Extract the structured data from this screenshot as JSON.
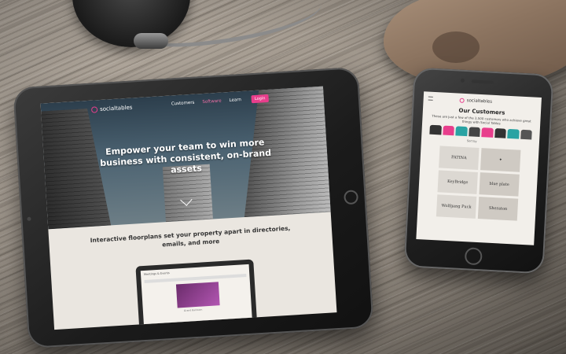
{
  "tablet": {
    "logo": "socialtables",
    "nav": [
      "Customers",
      "Software",
      "Learn"
    ],
    "nav_active_index": 1,
    "login": "Login",
    "hero_title": "Empower your team to win more business with consistent, on-brand assets",
    "subheading": "Interactive floorplans set your property apart in directories, emails, and more",
    "laptop": {
      "header": "Meetings & Events",
      "image_label": "Grand Ballroom"
    }
  },
  "phone": {
    "logo": "socialtables",
    "title": "Our Customers",
    "text": "These are just a few of the 3,500 customers who achieve great things with Social Tables",
    "sort_label": "Sort by",
    "customers": [
      "PATINA",
      "",
      "KeyBridge",
      "blue plate",
      "Wolfgang Puck",
      "Sheraton"
    ]
  },
  "colors": {
    "accent": "#e83e8c"
  }
}
